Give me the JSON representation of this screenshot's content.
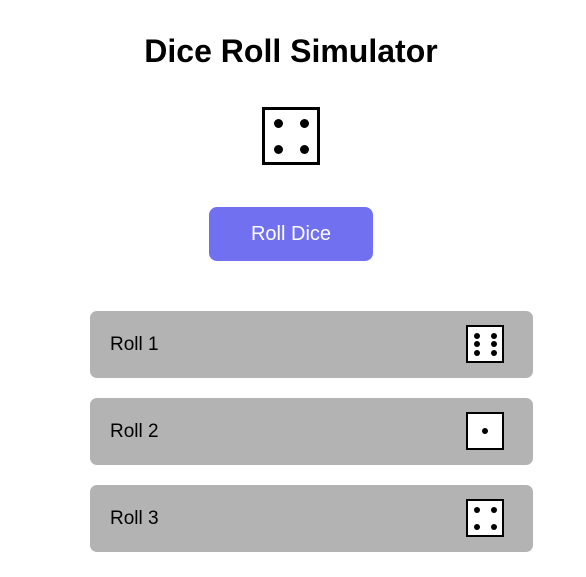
{
  "app": {
    "title": "Dice Roll Simulator"
  },
  "current_die": {
    "value": 4,
    "icon": "die-face-4-icon"
  },
  "roll_button": {
    "label": "Roll Dice",
    "color": "#7070f0",
    "text_color": "#ffffff"
  },
  "history": {
    "row_color": "#b3b3b3",
    "rolls": [
      {
        "label": "Roll 1",
        "value": 6,
        "icon": "die-face-6-icon"
      },
      {
        "label": "Roll 2",
        "value": 1,
        "icon": "die-face-1-icon"
      },
      {
        "label": "Roll 3",
        "value": 4,
        "icon": "die-face-4-icon"
      }
    ]
  }
}
